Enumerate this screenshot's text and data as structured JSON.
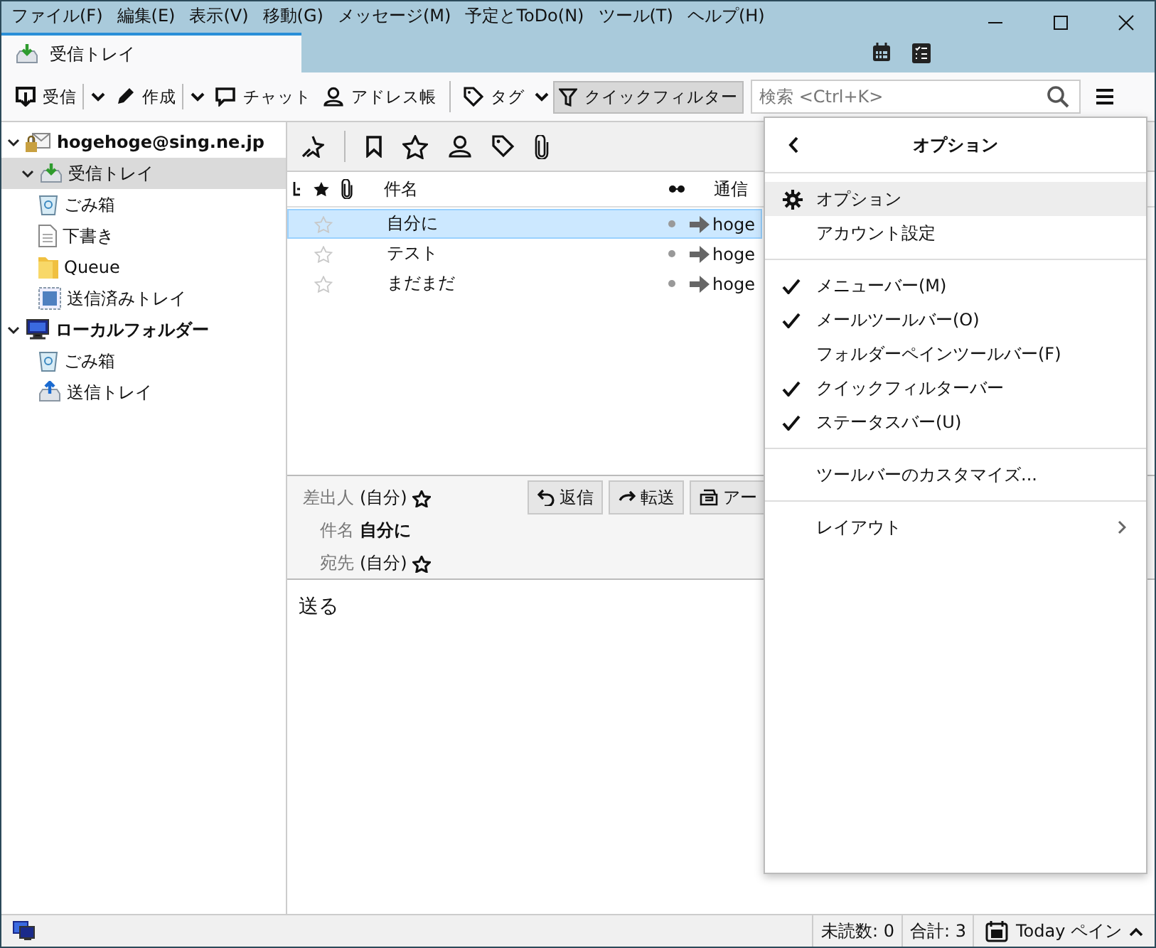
{
  "menubar": [
    "ファイル(F)",
    "編集(E)",
    "表示(V)",
    "移動(G)",
    "メッセージ(M)",
    "予定とToDo(N)",
    "ツール(T)",
    "ヘルプ(H)"
  ],
  "tabs": [
    {
      "label": "受信トレイ",
      "selected": true
    }
  ],
  "toolbar": [
    {
      "label": "受信",
      "dropdown": true,
      "selected": false
    },
    {
      "label": "作成",
      "dropdown": true,
      "selected": false
    },
    {
      "label": "チャット",
      "dropdown": false,
      "selected": false
    },
    {
      "label": "アドレス帳",
      "dropdown": false,
      "selected": false
    },
    {
      "label": "タグ",
      "dropdown": true,
      "selected": false
    },
    {
      "label": "クイックフィルター",
      "dropdown": false,
      "selected": true
    }
  ],
  "search": {
    "placeholder": "検索 <Ctrl+K>"
  },
  "folders": [
    {
      "label": "hogehoge@sing.ne.jp",
      "expanded": true,
      "selected": false,
      "children": [
        {
          "label": "受信トレイ",
          "expanded": true,
          "selected": true
        },
        {
          "label": "ごみ箱",
          "selected": false
        },
        {
          "label": "下書き",
          "selected": false
        },
        {
          "label": "Queue",
          "selected": false
        },
        {
          "label": "送信済みトレイ",
          "selected": false
        }
      ]
    },
    {
      "label": "ローカルフォルダー",
      "expanded": true,
      "selected": false,
      "children": [
        {
          "label": "ごみ箱",
          "selected": false
        },
        {
          "label": "送信トレイ",
          "selected": false
        }
      ]
    }
  ],
  "message_list": {
    "columns": [
      "件名",
      "通信"
    ],
    "rows": [
      {
        "subject": "自分に",
        "correspondent": "hoge",
        "selected": true
      },
      {
        "subject": "テスト",
        "correspondent": "hoge",
        "selected": false
      },
      {
        "subject": "まだまだ",
        "correspondent": "hoge",
        "selected": false
      }
    ]
  },
  "message_header": {
    "fields": [
      {
        "label": "差出人",
        "value": "(自分)",
        "kind": "address"
      },
      {
        "label": "件名",
        "value": "自分に",
        "kind": "subject"
      },
      {
        "label": "宛先",
        "value": "(自分)",
        "kind": "address"
      }
    ],
    "buttons": [
      "返信",
      "転送",
      "アー"
    ]
  },
  "message_body": "送る",
  "menu_panel": {
    "title": "オプション",
    "items": [
      {
        "kind": "item",
        "label": "オプション",
        "selected": true
      },
      {
        "kind": "item",
        "label": "アカウント設定",
        "selected": false
      },
      {
        "kind": "separator"
      },
      {
        "kind": "check",
        "label": "メニューバー(M)",
        "checked": true,
        "selected": false
      },
      {
        "kind": "check",
        "label": "メールツールバー(O)",
        "checked": true,
        "selected": false
      },
      {
        "kind": "check",
        "label": "フォルダーペインツールバー(F)",
        "checked": false,
        "selected": false
      },
      {
        "kind": "check",
        "label": "クイックフィルターバー",
        "checked": true,
        "selected": false
      },
      {
        "kind": "check",
        "label": "ステータスバー(U)",
        "checked": true,
        "selected": false
      },
      {
        "kind": "separator"
      },
      {
        "kind": "item",
        "label": "ツールバーのカスタマイズ...",
        "selected": false
      },
      {
        "kind": "separator"
      },
      {
        "kind": "submenu",
        "label": "レイアウト",
        "selected": false
      }
    ]
  },
  "status_bar": {
    "unread": "未読数: 0",
    "total": "合計: 3",
    "today_pane": "Today ペイン"
  }
}
